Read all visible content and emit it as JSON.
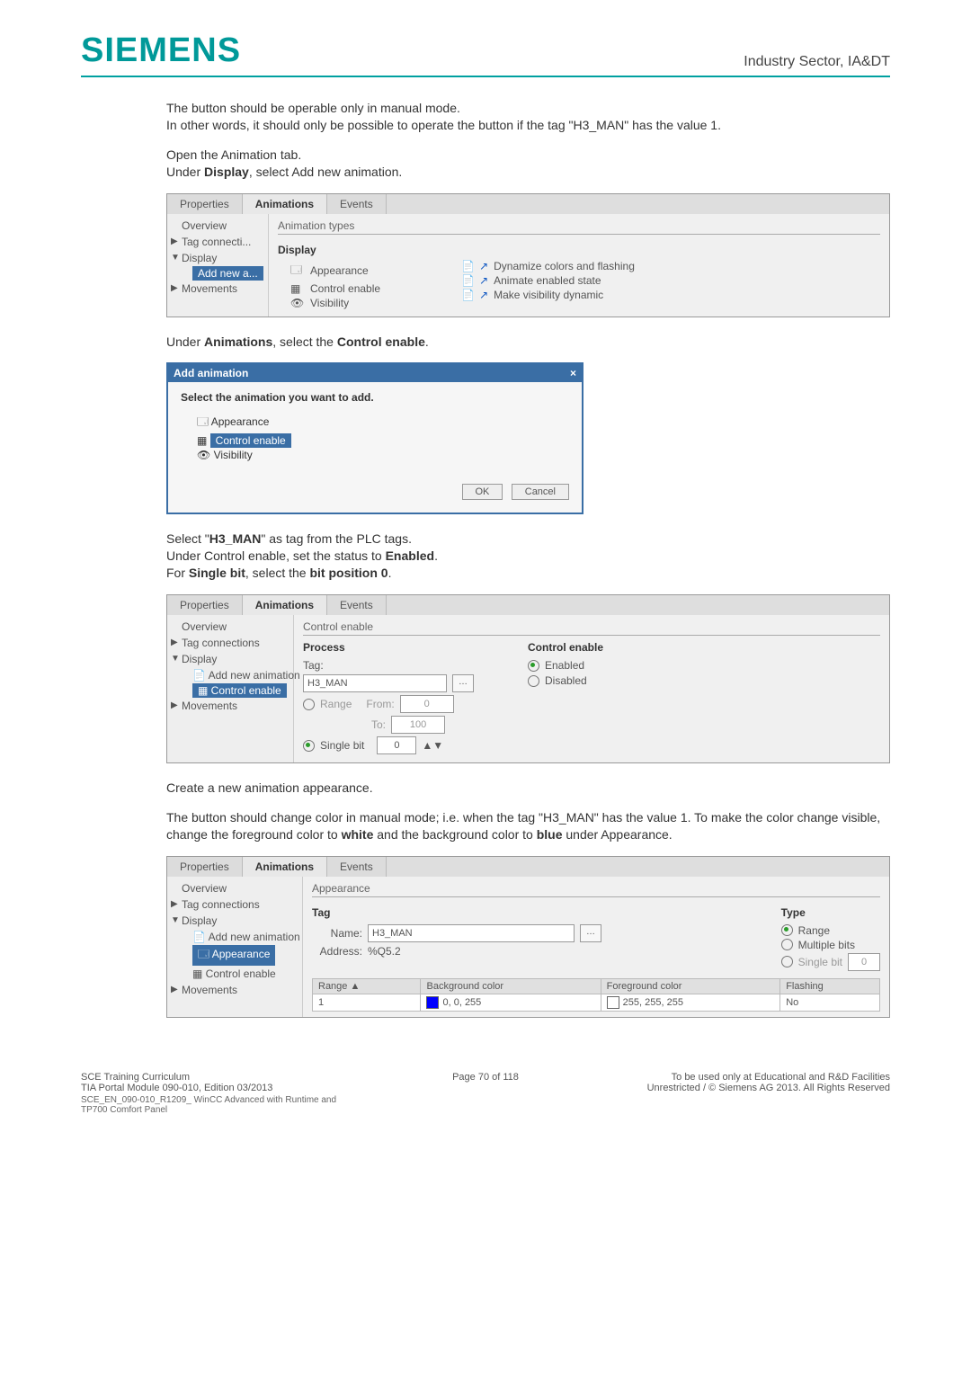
{
  "header": {
    "logo": "SIEMENS",
    "right": "Industry Sector, IA&DT"
  },
  "body": {
    "p1a": "The button should be operable only in manual mode.",
    "p1b": "In other words, it should only be possible to operate the button if the tag \"H3_MAN\" has the value 1.",
    "p2a": "Open the Animation tab.",
    "p2b_pre": "Under ",
    "p2b_bold": "Display",
    "p2b_post": ", select Add new animation.",
    "p3_pre": "Under ",
    "p3_b1": "Animations",
    "p3_mid": ", select the ",
    "p3_b2": "Control enable",
    "p3_post": ".",
    "p4a_pre": "Select \"",
    "p4a_bold": "H3_MAN",
    "p4a_post": "\" as tag from the PLC tags.",
    "p4b_pre": "Under Control enable, set the status to ",
    "p4b_bold": "Enabled",
    "p4b_post": ".",
    "p4c_pre": "For ",
    "p4c_b1": "Single bit",
    "p4c_mid": ", select the ",
    "p4c_b2": "bit position 0",
    "p4c_post": ".",
    "p5": "Create a new animation appearance.",
    "p6_pre": "The button should change color in manual mode; i.e. when the tag \"H3_MAN\" has the value 1. To make the color change visible, change the foreground color to ",
    "p6_b1": "white",
    "p6_mid": " and the background color to ",
    "p6_b2": "blue",
    "p6_post": " under Appearance."
  },
  "panel1": {
    "tabs": [
      "Properties",
      "Animations",
      "Events"
    ],
    "section": "Animation types",
    "tree": [
      "Overview",
      "Tag connecti...",
      "Display",
      "Add new a...",
      "Movements"
    ],
    "display_h": "Display",
    "options": [
      "Appearance",
      "Control enable",
      "Visibility"
    ],
    "dynopts": [
      "Dynamize colors and flashing",
      "Animate enabled state",
      "Make visibility dynamic"
    ]
  },
  "dialog": {
    "title": "Add animation",
    "close": "×",
    "prompt": "Select the animation you want to add.",
    "items": [
      "Appearance",
      "Control enable",
      "Visibility"
    ],
    "ok": "OK",
    "cancel": "Cancel"
  },
  "panel3": {
    "tabs": [
      "Properties",
      "Animations",
      "Events"
    ],
    "section": "Control enable",
    "tree": [
      "Overview",
      "Tag connections",
      "Display",
      "Add new animation",
      "Control enable",
      "Movements"
    ],
    "process_h": "Process",
    "tag_label": "Tag:",
    "tag_value": "H3_MAN",
    "range": "Range",
    "from": "From:",
    "from_v": "0",
    "to": "To:",
    "to_v": "100",
    "singlebit": "Single bit",
    "singlebit_v": "0",
    "ctl_h": "Control enable",
    "enabled": "Enabled",
    "disabled": "Disabled"
  },
  "panel4": {
    "tabs": [
      "Properties",
      "Animations",
      "Events"
    ],
    "section": "Appearance",
    "tree": [
      "Overview",
      "Tag connections",
      "Display",
      "Add new animation",
      "Appearance",
      "Control enable",
      "Movements"
    ],
    "tag_h": "Tag",
    "name_l": "Name:",
    "name_v": "H3_MAN",
    "addr_l": "Address:",
    "addr_v": "%Q5.2",
    "type_h": "Type",
    "opt_range": "Range",
    "opt_multi": "Multiple bits",
    "opt_single": "Single bit",
    "opt_single_v": "0",
    "cols": [
      "Range ▲",
      "Background color",
      "Foreground color",
      "Flashing"
    ],
    "row": {
      "range": "1",
      "bg": "0, 0, 255",
      "fg": "255, 255, 255",
      "flash": "No"
    }
  },
  "footer": {
    "l1": "SCE Training Curriculum",
    "l2": "TIA Portal Module 090-010, Edition 03/2013",
    "l3": "SCE_EN_090-010_R1209_ WinCC Advanced with Runtime and TP700 Comfort Panel",
    "c": "Page 70 of 118",
    "r1": "To be used only at Educational and R&D Facilities",
    "r2": "Unrestricted / © Siemens AG 2013. All Rights Reserved"
  }
}
